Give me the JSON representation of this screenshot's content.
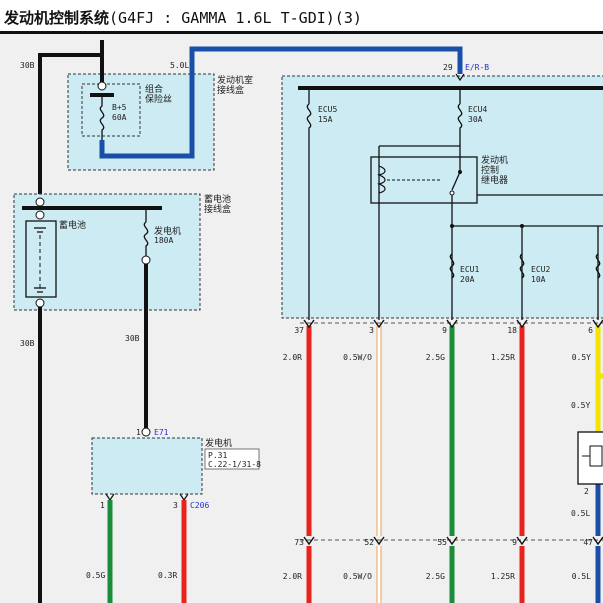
{
  "header": {
    "title_cn": "发动机控制系统",
    "title_rest": "(G4FJ : GAMMA 1.6L T-GDI)(3)"
  },
  "engine_room_box": {
    "title_1": "发动机室",
    "title_2": "接线盒"
  },
  "combo_fuse_box": {
    "title_1": "组合",
    "title_2": "保险丝",
    "fuse_name": "B+5",
    "fuse_rating": "60A"
  },
  "battery_box": {
    "title_1": "蓄电池",
    "title_2": "接线盒",
    "battery_label": "蓄电池",
    "alt_fuse_name": "发电机",
    "alt_fuse_rating": "180A"
  },
  "wires_left": {
    "top_30b": "30B",
    "bottom_30b": "30B",
    "alt_wire": "30B",
    "blue_5l": "5.0L"
  },
  "pcb": {
    "top_connector_pin": "29",
    "top_connector_id": "E/R-B",
    "ecu5_name": "ECU5",
    "ecu5_rating": "15A",
    "ecu4_name": "ECU4",
    "ecu4_rating": "30A",
    "relay_1": "发动机",
    "relay_2": "控制",
    "relay_3": "继电器",
    "ecu1_name": "ECU1",
    "ecu1_rating": "20A",
    "ecu2_name": "ECU2",
    "ecu2_rating": "10A"
  },
  "generator": {
    "pin_top": "1",
    "connector_top": "E71",
    "name": "发电机",
    "ref_1": "P.31",
    "ref_2": "C.22-1/31-8",
    "pin_b1": "1",
    "pin_b3": "3",
    "connector_bottom": "C206",
    "wire_b1": "0.5G",
    "wire_b3": "0.3R"
  },
  "output_pins": {
    "pins_top": [
      "37",
      "3",
      "9",
      "18",
      "6"
    ],
    "wires_a": [
      "2.0R",
      "0.5W/O",
      "2.5G",
      "1.25R",
      "0.5Y"
    ],
    "wire_a2": "0.5Y",
    "pins_mid": [
      "73",
      "52",
      "55",
      "9",
      "47"
    ],
    "wires_b": [
      "2.0R",
      "0.5W/O",
      "2.5G",
      "1.25R",
      "0.5L"
    ],
    "wire_b_upper": "0.5L",
    "pin_small": "2"
  },
  "colors": {
    "box_fill": "#cdebf3",
    "wire_blue": "#1a4fa8",
    "wire_red": "#e8231b",
    "wire_green": "#1a8c3a",
    "wire_yellow": "#f2e400",
    "wire_orange_white": "#f0b070",
    "wire_black": "#111111"
  }
}
